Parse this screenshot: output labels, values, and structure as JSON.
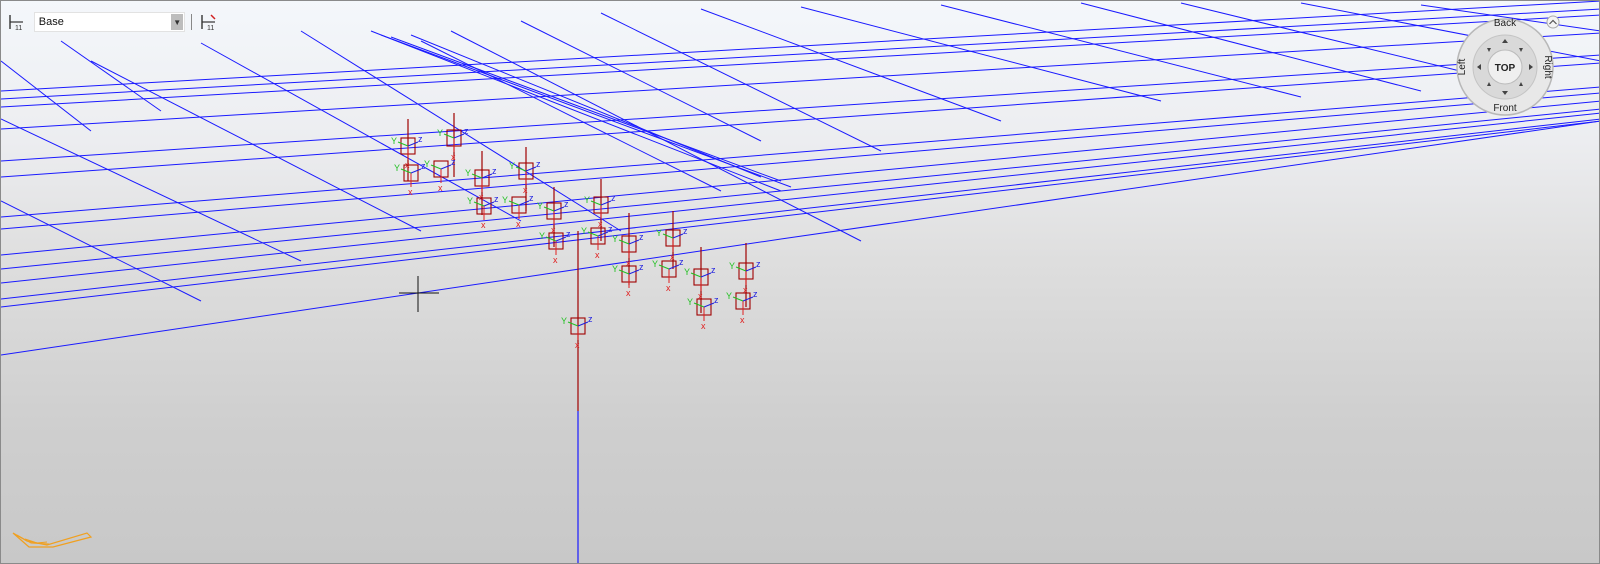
{
  "toolbar": {
    "level_icon": "level-grid-icon",
    "level_value": "Base",
    "dropdown_icon": "chevron-down-icon",
    "level_edit_icon": "level-edit-icon"
  },
  "viewcube": {
    "top": "TOP",
    "back": "Back",
    "front": "Front",
    "left": "Left",
    "right": "Right",
    "collapse_icon": "chevron-up-icon"
  },
  "axis_labels": {
    "x": "x",
    "y": "Y",
    "z": "z"
  },
  "colors": {
    "grid": "#1a1aff",
    "frame": "#a00000",
    "axis_x": "#e02020",
    "axis_y": "#22c022",
    "axis_z": "#2020e0",
    "ucs": "#f0a020"
  }
}
